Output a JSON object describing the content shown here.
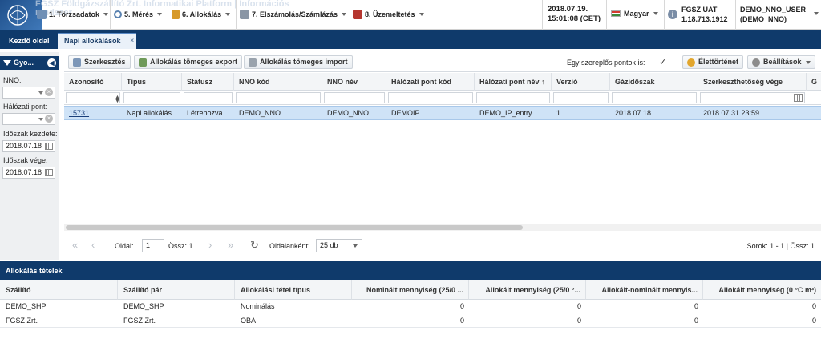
{
  "header": {
    "ghost_text": "FGSZ Földgázszállító Zrt. Informatikai Platform | Információs rendszer",
    "menus": [
      {
        "label": "1. Törzsadatok",
        "icon": "master-data-icon",
        "color": "#6f8fb5"
      },
      {
        "label": "5. Mérés",
        "icon": "magnifier-icon",
        "color": "#5a82b0"
      },
      {
        "label": "6. Allokálás",
        "icon": "lock-icon",
        "color": "#d79a2b"
      },
      {
        "label": "7. Elszámolás/Számlázás",
        "icon": "printer-icon",
        "color": "#8a96a5"
      },
      {
        "label": "8. Üzemeltetés",
        "icon": "toolbox-icon",
        "color": "#b5362f"
      }
    ],
    "date": "2018.07.19.",
    "time": "15:01:08 (CET)",
    "language": "Magyar",
    "env": "FGSZ UAT",
    "version": "1.18.713.1912",
    "user": "DEMO_NNO_USER",
    "user_org": "(DEMO_NNO)"
  },
  "tabs": {
    "home": "Kezdő oldal",
    "active": "Napi allokálások",
    "close": "×"
  },
  "filters": {
    "panel_title": "Gyo...",
    "nno_label": "NNO:",
    "point_label": "Hálózati pont:",
    "start_label": "Időszak kezdete:",
    "start_value": "2018.07.18",
    "end_label": "Időszak vége:",
    "end_value": "2018.07.18"
  },
  "toolbar": {
    "edit": "Szerkesztés",
    "export": "Allokálás tömeges export",
    "import": "Allokálás tömeges import",
    "single_party": "Egy szereplős pontok is:",
    "check": "✓",
    "history": "Élettörténet",
    "settings": "Beállítások"
  },
  "grid": {
    "columns": [
      "Azonosító",
      "Típus",
      "Státusz",
      "NNO kód",
      "NNO név",
      "Hálózati pont kód",
      "Hálózati pont név ↑",
      "Verzió",
      "Gázidőszak",
      "Szerkeszthetőség vége",
      "G"
    ],
    "row": [
      "15731",
      "Napi allokálás",
      "Létrehozva",
      "DEMO_NNO",
      "DEMO_NNO",
      "DEMOIP",
      "DEMO_IP_entry",
      "1",
      "2018.07.18.",
      "2018.07.31 23:59",
      ""
    ]
  },
  "pager": {
    "first": "«",
    "prev": "‹",
    "page_label": "Oldal:",
    "page": "1",
    "total": "Össz: 1",
    "next": "›",
    "last": "»",
    "refresh": "↻",
    "per_page_label": "Oldalanként:",
    "per_page": "25 db",
    "rows_info": "Sorok: 1 - 1 | Össz: 1"
  },
  "items": {
    "title": "Allokálás tételek",
    "columns": [
      "Szállító",
      "Szállító pár",
      "Allokálási tétel típus",
      "Nominált mennyiség (25/0 ...",
      "Allokált mennyiség (25/0 °...",
      "Allokált-nominált mennyis...",
      "Allokált mennyiség (0 °C m³)"
    ],
    "rows": [
      [
        "DEMO_SHP",
        "DEMO_SHP",
        "Nominálás",
        "0",
        "0",
        "0",
        "0"
      ],
      [
        "FGSZ Zrt.",
        "FGSZ Zrt.",
        "OBA",
        "0",
        "0",
        "0",
        "0"
      ]
    ]
  },
  "colors": {
    "navy": "#0f3a6b",
    "selected_row": "#cfe3f7"
  }
}
